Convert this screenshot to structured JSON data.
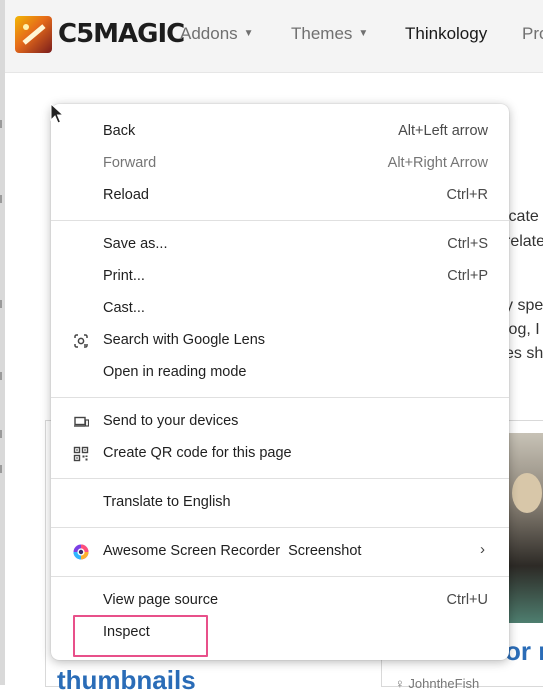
{
  "site": {
    "logo_text": "C5MAGIC",
    "nav": [
      {
        "label": "Addons",
        "has_caret": true
      },
      {
        "label": "Themes",
        "has_caret": true
      },
      {
        "label": "Thinkology",
        "has_caret": false
      },
      {
        "label": "Pro",
        "has_caret": false
      }
    ],
    "content_fragments": [
      "icate",
      "relate",
      "y spe",
      "log, I",
      "es sh"
    ],
    "card_titles": [
      "thumbnails",
      "or n"
    ],
    "card_meta": "JohntheFish"
  },
  "context_menu": {
    "items": [
      {
        "label": "Back",
        "shortcut": "Alt+Left arrow",
        "enabled": true
      },
      {
        "label": "Forward",
        "shortcut": "Alt+Right Arrow",
        "enabled": false
      },
      {
        "label": "Reload",
        "shortcut": "Ctrl+R",
        "enabled": true
      },
      {
        "label": "Save as...",
        "shortcut": "Ctrl+S",
        "enabled": true
      },
      {
        "label": "Print...",
        "shortcut": "Ctrl+P",
        "enabled": true
      },
      {
        "label": "Cast...",
        "shortcut": "",
        "enabled": true
      },
      {
        "label": "Search with Google Lens",
        "shortcut": "",
        "icon": "google-lens-icon",
        "enabled": true
      },
      {
        "label": "Open in reading mode",
        "shortcut": "",
        "enabled": true
      },
      {
        "label": "Send to your devices",
        "shortcut": "",
        "icon": "devices-icon",
        "enabled": true
      },
      {
        "label": "Create QR code for this page",
        "shortcut": "",
        "icon": "qr-code-icon",
        "enabled": true
      },
      {
        "label": "Translate to English",
        "shortcut": "",
        "enabled": true
      },
      {
        "label": "Awesome Screen Recorder  Screenshot",
        "shortcut": "",
        "icon": "screen-recorder-icon",
        "submenu": true,
        "enabled": true
      },
      {
        "label": "View page source",
        "shortcut": "Ctrl+U",
        "enabled": true
      },
      {
        "label": "Inspect",
        "shortcut": "",
        "enabled": true,
        "highlighted": true
      }
    ]
  },
  "colors": {
    "highlight_border": "#e8508a",
    "link_blue": "#2a6cb7",
    "menu_background": "#ffffff"
  }
}
